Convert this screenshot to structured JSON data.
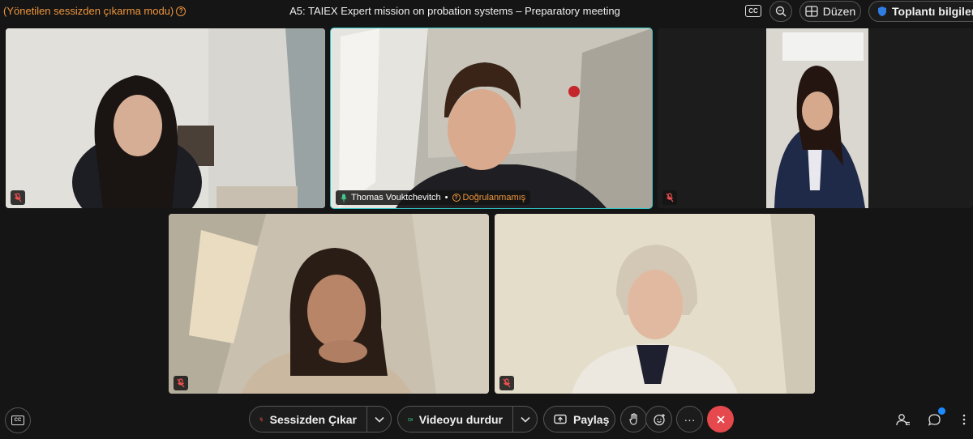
{
  "topbar": {
    "mode_label": "(Yönetilen sessizden çıkarma modu)",
    "meeting_title": "A5: TAIEX Expert mission on probation systems – Preparatory meeting",
    "cc_label": "CC",
    "layout_label": "Düzen",
    "info_label": "Toplantı bilgileri"
  },
  "participants": [
    {
      "id": "p1",
      "muted": true
    },
    {
      "id": "p2",
      "muted": false,
      "active_speaker": true,
      "name": "Thomas Vouktchevitch",
      "separator": "•",
      "status": "Doğrulanmamış"
    },
    {
      "id": "p3",
      "muted": true
    },
    {
      "id": "p4",
      "muted": true
    },
    {
      "id": "p5",
      "muted": true
    }
  ],
  "controls": {
    "cc_label": "CC",
    "unmute_label": "Sessizden Çıkar",
    "video_label": "Videoyu durdur",
    "share_label": "Paylaş",
    "more_label": "···"
  },
  "colors": {
    "accent_warning": "#f0963c",
    "active_outline": "#2ec4c4",
    "end_call": "#e5484d",
    "video_green": "#3ecf8e",
    "notification": "#1d8bff"
  }
}
